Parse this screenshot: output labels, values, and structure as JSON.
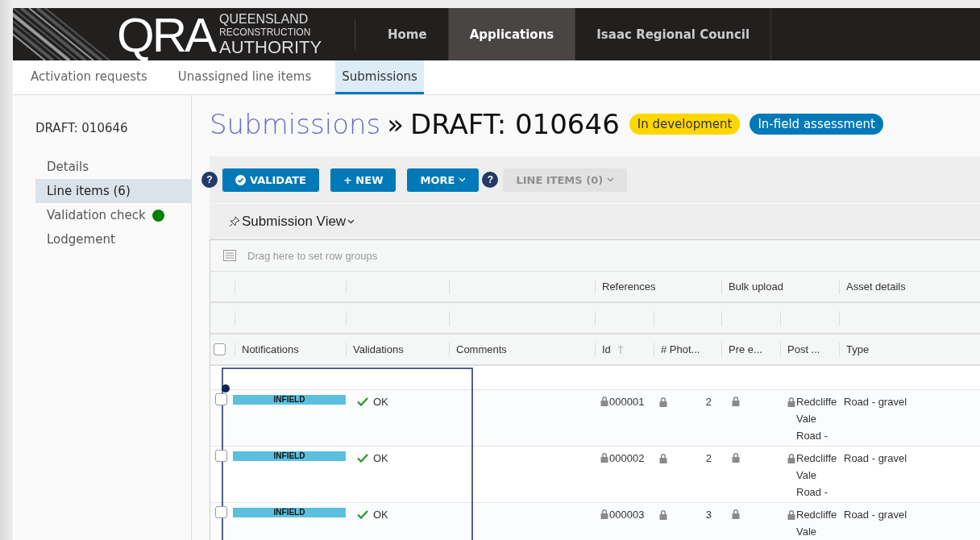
{
  "header": {
    "logo": {
      "mark": "QRA",
      "lines": [
        "QUEENSLAND",
        "RECONSTRUCTION",
        "AUTHORITY"
      ]
    },
    "nav": [
      {
        "label": "Home",
        "selected": false
      },
      {
        "label": "Applications",
        "selected": true
      },
      {
        "label": "Isaac Regional Council",
        "selected": false
      }
    ]
  },
  "subnav": [
    {
      "label": "Activation requests",
      "selected": false
    },
    {
      "label": "Unassigned line items",
      "selected": false
    },
    {
      "label": "Submissions",
      "selected": true
    }
  ],
  "sidebar": {
    "title": "DRAFT: 010646",
    "items": [
      {
        "label": "Details",
        "selected": false
      },
      {
        "label": "Line items (6)",
        "selected": true
      },
      {
        "label": "Validation check",
        "selected": false,
        "color": "#008000"
      },
      {
        "label": "Lodgement",
        "selected": false
      }
    ]
  },
  "page": {
    "breadcrumb": "Submissions",
    "separator": "»",
    "title": "DRAFT: 010646",
    "badges": [
      {
        "label": "In development",
        "color": "#ffd700"
      },
      {
        "label": "In-field assessment",
        "color": "#0079b8"
      }
    ]
  },
  "toolbar": [
    {
      "kind": "help",
      "label": "?"
    },
    {
      "kind": "check-action",
      "label": "VALIDATE",
      "disabled": false
    },
    {
      "kind": "action",
      "label": "+ NEW",
      "disabled": false
    },
    {
      "kind": "menu",
      "label": "MORE",
      "disabled": false
    },
    {
      "kind": "help",
      "label": "?"
    },
    {
      "kind": "menu",
      "label": "LINE ITEMS (0)",
      "disabled": true
    }
  ],
  "view": {
    "label": "Submission View"
  },
  "grid": {
    "group_panel": {
      "placeholder": "Drag here to set row groups"
    },
    "header_checkbox": {
      "checked": false
    },
    "columns": [
      {
        "label": "Notifications",
        "sorted": false
      },
      {
        "label": "Validations",
        "sorted": false
      },
      {
        "label": "Comments",
        "sorted": false
      },
      {
        "label": "Id",
        "group": "References",
        "sorted": true
      },
      {
        "label": "# Phot...",
        "sorted": false
      },
      {
        "label": "Pre e...",
        "group": "Bulk upload",
        "sorted": false
      },
      {
        "label": "Post ...",
        "sorted": false
      },
      {
        "label": "Type",
        "group": "Asset details",
        "sorted": false
      }
    ],
    "rows": [
      {
        "checked": false,
        "notification": "INFIELD",
        "validation": "OK",
        "id": "000001",
        "photos": "2",
        "post": "Redcliffe Vale Road -",
        "type": "Road - gravel",
        "locked": true
      },
      {
        "checked": false,
        "notification": "INFIELD",
        "validation": "OK",
        "id": "000002",
        "photos": "2",
        "post": "Redcliffe Vale Road -",
        "type": "Road - gravel",
        "locked": true
      },
      {
        "checked": false,
        "notification": "INFIELD",
        "validation": "OK",
        "id": "000003",
        "photos": "3",
        "post": "Redcliffe Vale",
        "type": "Road - gravel",
        "locked": true
      }
    ]
  }
}
